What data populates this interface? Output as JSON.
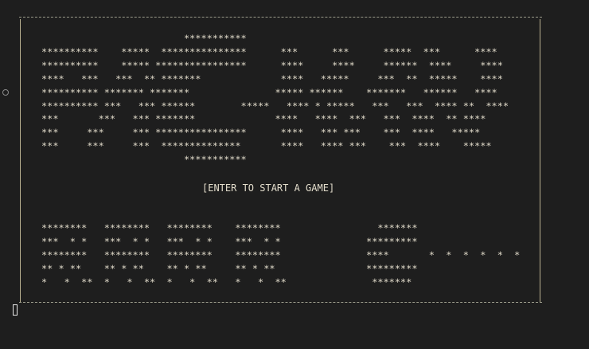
{
  "terminal": {
    "title_art": "                         ***********\n**********    *****  ***************      ***      ***      *****  ***      ****\n**********    ***** ****************      ****     ****     ******  ****     ****\n****   ***   ***  ** *******              ****   *****     ***  **  *****    ****\n********** ******* *******               ***** ******    *******   ******   ****\n********** ***   *** ******        *****   **** * *****   ***   ***  **** **  ****\n***       ***   *** *******              ****   ****  ***   ***  ****  ** ****\n***     ***     *** ****************      ****   *** ***    ***  ****   *****\n***     ***     ***  **************       ****   **** ***    ***  ****    *****\n                         ***********",
    "prompt": "[ENTER TO START A GAME]",
    "sprites_art": "********   ********   ********    ********                 *******\n***  * *   ***  * *   ***  * *    ***  * *               *********\n********   ********   ********    ********               ****       *  *  *  *  *  *\n** * **    ** * **    ** * **     ** * **                *********\n*   *  **  *   *  **  *   *  **   *   *  **               *******"
  }
}
